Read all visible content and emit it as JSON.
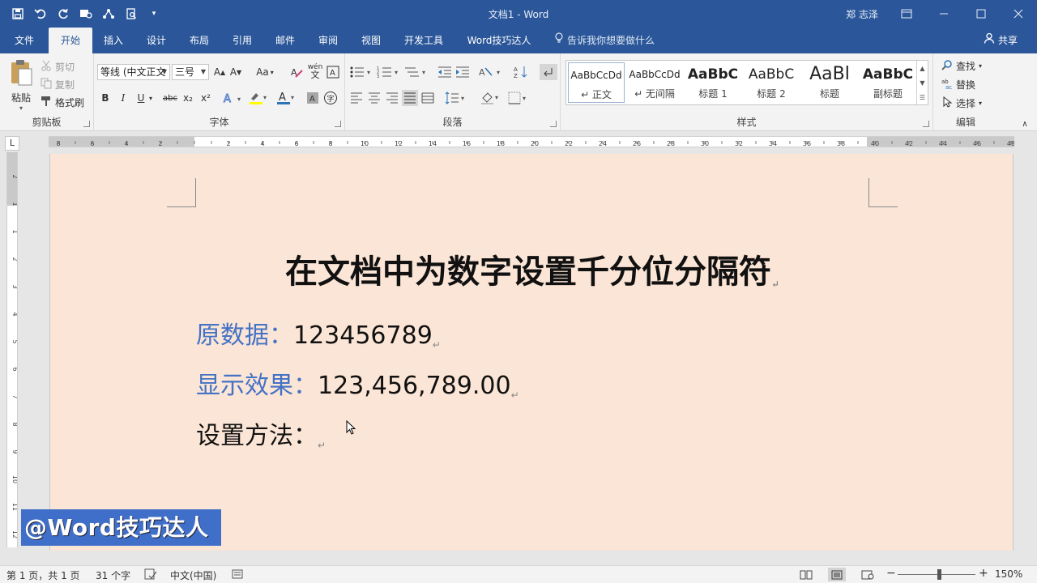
{
  "titlebar": {
    "document_title": "文档1  -  Word",
    "user": "郑 志泽",
    "qat": [
      "save-icon",
      "undo-icon",
      "redo-icon",
      "touch-mode-icon",
      "share-icon",
      "print-preview-icon",
      "customize-icon"
    ]
  },
  "tabs": [
    {
      "label": "文件",
      "active": false
    },
    {
      "label": "开始",
      "active": true
    },
    {
      "label": "插入",
      "active": false
    },
    {
      "label": "设计",
      "active": false
    },
    {
      "label": "布局",
      "active": false
    },
    {
      "label": "引用",
      "active": false
    },
    {
      "label": "邮件",
      "active": false
    },
    {
      "label": "审阅",
      "active": false
    },
    {
      "label": "视图",
      "active": false
    },
    {
      "label": "开发工具",
      "active": false
    },
    {
      "label": "Word技巧达人",
      "active": false
    }
  ],
  "tell_me": "告诉我你想要做什么",
  "share": "共享",
  "clipboard": {
    "label": "剪贴板",
    "paste": "粘贴",
    "cut": "剪切",
    "copy": "复制",
    "format_painter": "格式刷"
  },
  "font": {
    "label": "字体",
    "font_name": "等线 (中文正文",
    "font_size": "三号",
    "phonetic_glyph": "wén",
    "change_case": "Aa",
    "bold": "B",
    "italic": "I",
    "underline": "U",
    "strikethrough": "abc",
    "subscript": "x₂",
    "superscript": "x²"
  },
  "paragraph": {
    "label": "段落"
  },
  "styles": {
    "label": "样式",
    "items": [
      {
        "preview": "AaBbCcDd",
        "name": "↵ 正文",
        "selected": true
      },
      {
        "preview": "AaBbCcDd",
        "name": "↵ 无间隔",
        "selected": false
      },
      {
        "preview": "AaBbC",
        "name": "标题 1",
        "selected": false
      },
      {
        "preview": "AaBbC",
        "name": "标题 2",
        "selected": false
      },
      {
        "preview": "AaBl",
        "name": "标题",
        "selected": false
      },
      {
        "preview": "AaBbC",
        "name": "副标题",
        "selected": false
      }
    ]
  },
  "editing": {
    "label": "编辑",
    "find": "查找",
    "replace": "替换",
    "select": "选择"
  },
  "ruler": {
    "tab_selector": "L",
    "h_left_labels": [
      "8",
      "6",
      "4",
      "2"
    ],
    "h_right_labels": [
      "2",
      "4",
      "6",
      "8",
      "10",
      "12",
      "14",
      "16",
      "18",
      "20",
      "22",
      "24",
      "26",
      "28",
      "30",
      "32",
      "34",
      "36",
      "38",
      "40",
      "42",
      "44",
      "46",
      "48"
    ],
    "v_labels": [
      "2",
      "1",
      "1",
      "2",
      "3",
      "4",
      "5",
      "6",
      "7",
      "8",
      "9",
      "10",
      "11",
      "12",
      "13"
    ]
  },
  "document": {
    "title": "在文档中为数字设置千分位分隔符",
    "para_mark": "↵",
    "lines": [
      {
        "label": "原数据：",
        "value": "123456789"
      },
      {
        "label": "显示效果：",
        "value": "123,456,789.00"
      },
      {
        "label": "设置方法：",
        "value": ""
      }
    ]
  },
  "watermark": "@Word技巧达人",
  "statusbar": {
    "page": "第 1 页，共 1 页",
    "words": "31 个字",
    "language": "中文(中国)",
    "zoom": "150%",
    "zoom_fraction": 0.53
  },
  "colors": {
    "word_blue": "#2b579a",
    "page_background": "#fbe5d6",
    "label_blue": "#4472c4"
  }
}
